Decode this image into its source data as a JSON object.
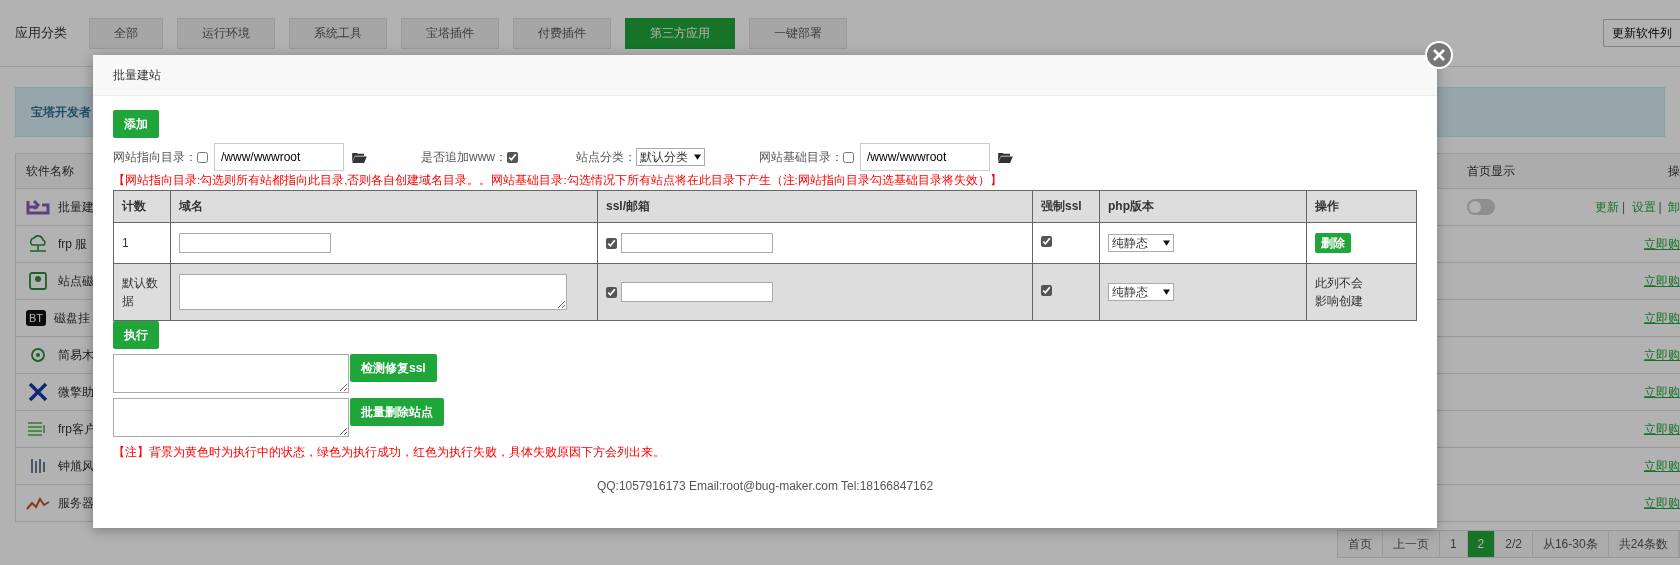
{
  "category_bar": {
    "label": "应用分类",
    "tabs": [
      {
        "label": "全部",
        "selected": false
      },
      {
        "label": "运行环境",
        "selected": false
      },
      {
        "label": "系统工具",
        "selected": false
      },
      {
        "label": "宝塔插件",
        "selected": false
      },
      {
        "label": "付费插件",
        "selected": false
      },
      {
        "label": "第三方应用",
        "selected": true
      },
      {
        "label": "一键部署",
        "selected": false
      }
    ],
    "refresh_button": "更新软件列"
  },
  "notice": "宝塔开发者",
  "software_table": {
    "columns": [
      "软件名称",
      "首页显示",
      "操"
    ],
    "rows": [
      {
        "name": "批量建",
        "kind": "installed",
        "toggle_on": false,
        "actions": [
          "更新",
          "设置",
          "卸"
        ],
        "separator": "|"
      },
      {
        "name": "frp 服",
        "kind": "buy",
        "action": "立即购"
      },
      {
        "name": "站点磁",
        "kind": "buy",
        "action": "立即购"
      },
      {
        "name": "磁盘挂",
        "logo_text": "BT",
        "kind": "buy",
        "action": "立即购"
      },
      {
        "name": "简易木",
        "kind": "buy",
        "action": "立即购"
      },
      {
        "name": "微擎助",
        "kind": "buy",
        "action": "立即购"
      },
      {
        "name": "frp客户",
        "kind": "buy",
        "action": "立即购"
      },
      {
        "name": "钟馗风",
        "kind": "buy",
        "action": "立即购"
      },
      {
        "name": "服务器",
        "kind": "buy",
        "action": "立即购"
      }
    ]
  },
  "pagination": [
    {
      "label": "首页",
      "selected": false
    },
    {
      "label": "上一页",
      "selected": false
    },
    {
      "label": "1",
      "selected": false
    },
    {
      "label": "2",
      "selected": true
    },
    {
      "label": "2/2",
      "selected": false
    },
    {
      "label": "从16-30条",
      "selected": false
    },
    {
      "label": "共24条数",
      "selected": false
    }
  ],
  "modal": {
    "title": "批量建站",
    "add_button": "添加",
    "options": {
      "site_dir_label": "网站指向目录：",
      "site_dir_checked": false,
      "site_dir_value": "/www/wwwroot",
      "www_label": "是否追加www：",
      "www_checked": true,
      "category_label": "站点分类：",
      "category_value": "默认分类",
      "base_dir_label": "网站基础目录：",
      "base_dir_checked": false,
      "base_dir_value": "/www/wwwroot"
    },
    "hint": "【网站指向目录:勾选则所有站都指向此目录,否则各自创建域名目录。。网站基础目录:勾选情况下所有站点将在此目录下产生（注:网站指向目录勾选基础目录将失效）】",
    "columns": [
      "计数",
      "域名",
      "ssl/邮箱",
      "强制ssl",
      "php版本",
      "操作"
    ],
    "rows": [
      {
        "kind": "entry",
        "count": "1",
        "ssl_checked": true,
        "force_ssl_checked": true,
        "php": "纯静态",
        "delete_button": "删除"
      },
      {
        "kind": "default",
        "count": "默认数据",
        "ssl_checked": true,
        "force_ssl_checked": true,
        "php": "纯静态",
        "note": "此列不会影响创建"
      }
    ],
    "execute_button": "执行",
    "tools": [
      {
        "button": "检测修复ssl"
      },
      {
        "button": "批量删除站点"
      }
    ],
    "note": "【注】背景为黄色时为执行中的状态，绿色为执行成功，红色为执行失败，具体失败原因下方会列出来。",
    "footer": "QQ:1057916173 Email:root@bug-maker.com Tel:18166847162"
  }
}
